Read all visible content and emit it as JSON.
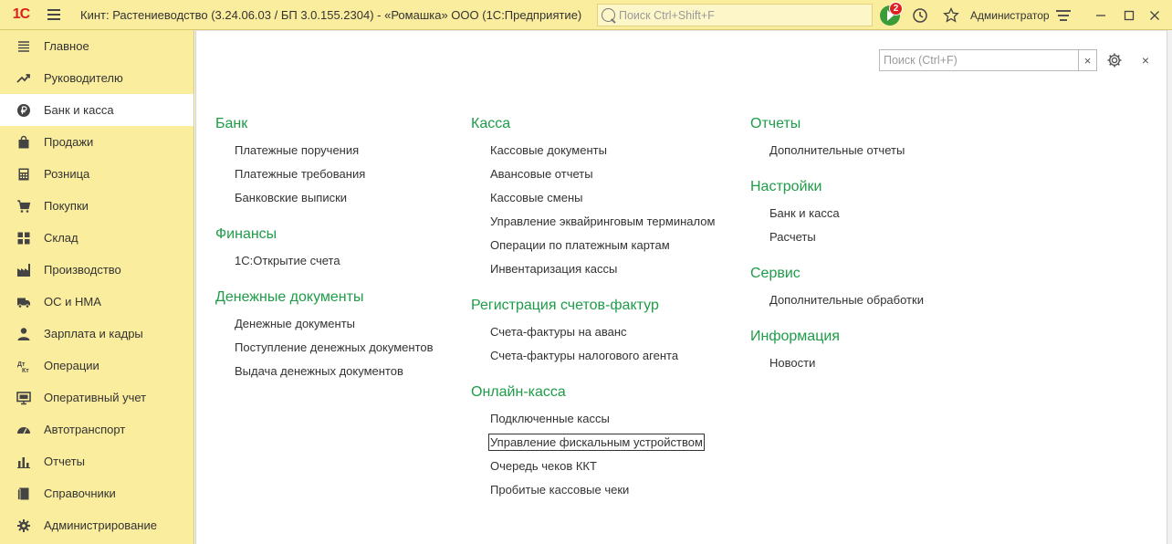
{
  "titlebar": {
    "logo": "1С",
    "title": "Кинт: Растениеводство (3.24.06.03 / БП 3.0.155.2304) - «Ромашка» ООО  (1С:Предприятие)",
    "search_placeholder": "Поиск Ctrl+Shift+F",
    "notification_count": "2",
    "user": "Администратор"
  },
  "sidebar": {
    "items": [
      {
        "label": "Главное",
        "icon": "list-icon"
      },
      {
        "label": "Руководителю",
        "icon": "trend-icon"
      },
      {
        "label": "Банк и касса",
        "icon": "ruble-coin-icon",
        "active": true
      },
      {
        "label": "Продажи",
        "icon": "shopping-bag-icon"
      },
      {
        "label": "Розница",
        "icon": "calculator-icon"
      },
      {
        "label": "Покупки",
        "icon": "cart-icon"
      },
      {
        "label": "Склад",
        "icon": "warehouse-grid-icon"
      },
      {
        "label": "Производство",
        "icon": "factory-icon"
      },
      {
        "label": "ОС и НМА",
        "icon": "truck-icon"
      },
      {
        "label": "Зарплата и кадры",
        "icon": "person-icon"
      },
      {
        "label": "Операции",
        "icon": "debit-credit-icon"
      },
      {
        "label": "Оперативный учет",
        "icon": "monitor-icon"
      },
      {
        "label": "Автотранспорт",
        "icon": "speedometer-icon"
      },
      {
        "label": "Отчеты",
        "icon": "bar-chart-icon"
      },
      {
        "label": "Справочники",
        "icon": "book-icon"
      },
      {
        "label": "Администрирование",
        "icon": "gear-icon"
      }
    ]
  },
  "main": {
    "search_placeholder": "Поиск (Ctrl+F)",
    "search_clear": "×",
    "close": "×",
    "columns": [
      [
        {
          "title": "Банк",
          "items": [
            "Платежные поручения",
            "Платежные требования",
            "Банковские выписки"
          ]
        },
        {
          "title": "Финансы",
          "items": [
            "1С:Открытие счета"
          ]
        },
        {
          "title": "Денежные документы",
          "items": [
            "Денежные документы",
            "Поступление денежных документов",
            "Выдача денежных документов"
          ]
        }
      ],
      [
        {
          "title": "Касса",
          "items": [
            "Кассовые документы",
            "Авансовые отчеты",
            "Кассовые смены",
            "Управление эквайринговым терминалом",
            "Операции по платежным картам",
            "Инвентаризация кассы"
          ]
        },
        {
          "title": "Регистрация счетов-фактур",
          "items": [
            "Счета-фактуры на аванс",
            "Счета-фактуры налогового агента"
          ]
        },
        {
          "title": "Онлайн-касса",
          "items": [
            "Подключенные кассы",
            "Управление фискальным устройством",
            "Очередь чеков ККТ",
            "Пробитые кассовые чеки"
          ]
        }
      ],
      [
        {
          "title": "Отчеты",
          "items": [
            "Дополнительные отчеты"
          ]
        },
        {
          "title": "Настройки",
          "items": [
            "Банк и касса",
            "Расчеты"
          ]
        },
        {
          "title": "Сервис",
          "items": [
            "Дополнительные обработки"
          ]
        },
        {
          "title": "Информация",
          "items": [
            "Новости"
          ]
        }
      ]
    ],
    "focused_item": "Управление фискальным устройством"
  }
}
